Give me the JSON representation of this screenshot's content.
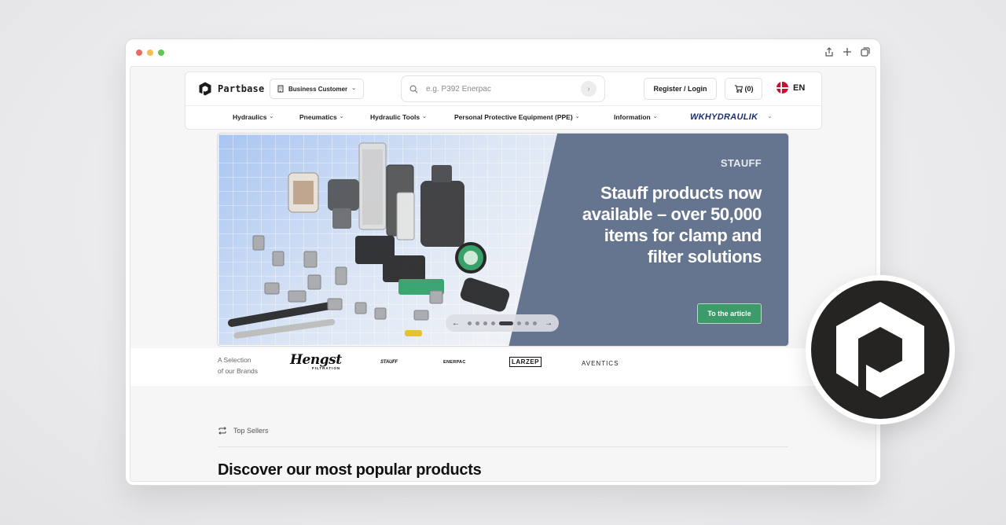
{
  "browser": {
    "controls": [
      "close",
      "minimize",
      "maximize"
    ],
    "toolbar_icons": [
      "share-icon",
      "new-tab-icon",
      "tabs-icon"
    ]
  },
  "header": {
    "logo_text": "Partbase",
    "customer_type": "Business Customer",
    "search_placeholder": "e.g. P392 Enerpac",
    "register_login": "Register / Login",
    "cart": "(0)",
    "language": "EN"
  },
  "nav": {
    "items": [
      {
        "label": "Hydraulics"
      },
      {
        "label": "Pneumatics"
      },
      {
        "label": "Hydraulic Tools"
      },
      {
        "label": "Personal Protective Equipment (PPE)"
      },
      {
        "label": "Information"
      }
    ],
    "partner_brand": "WKHYDRAULIK"
  },
  "hero": {
    "brand": "STAUFF",
    "title": "Stauff products now available – over 50,000 items for clamp and filter solutions",
    "cta": "To the article",
    "slide_count": 8,
    "active_slide": 5
  },
  "brands": {
    "label_line1": "A Selection",
    "label_line2": "of our Brands",
    "logos": [
      "Hengst",
      "STAUFF",
      "ENERPAC",
      "LARZEP",
      "AVENTICS"
    ],
    "hengst_sub": "FILTRATION"
  },
  "top_sellers": {
    "label": "Top Sellers",
    "heading": "Discover our most popular products"
  },
  "colors": {
    "hero_panel": "#66758f",
    "cta": "#3d9b6a",
    "partner_brand": "#1d2f6f",
    "badge": "#262323"
  }
}
